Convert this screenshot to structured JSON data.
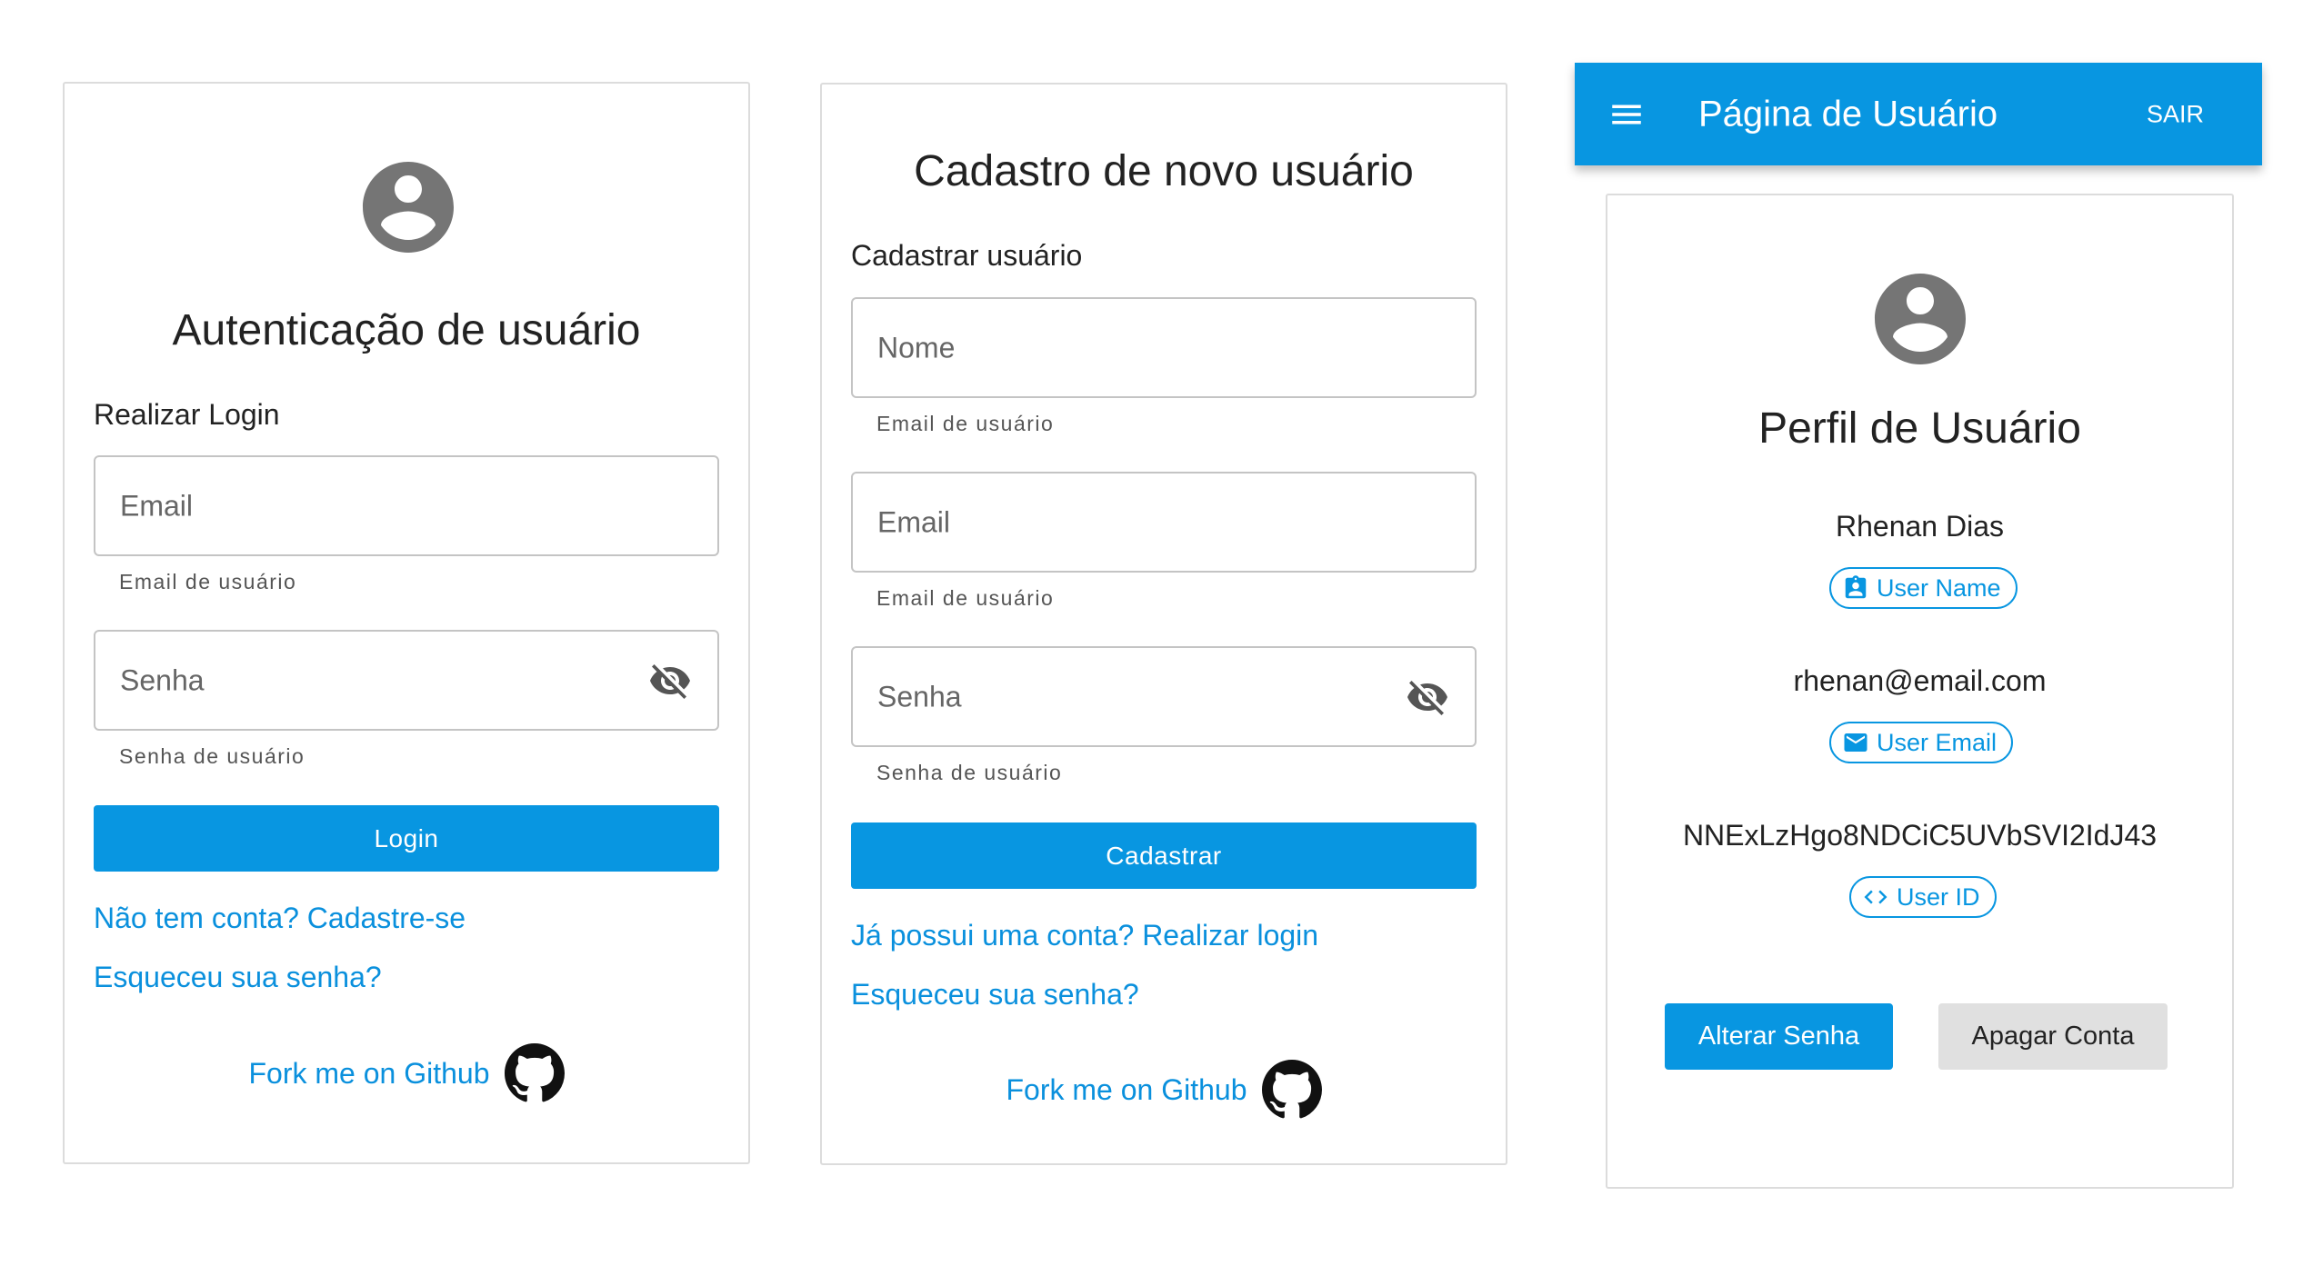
{
  "login": {
    "title": "Autenticação de usuário",
    "subtitle": "Realizar Login",
    "email_placeholder": "Email",
    "email_helper": "Email de usuário",
    "password_placeholder": "Senha",
    "password_helper": "Senha de usuário",
    "button": "Login",
    "register_link": "Não tem conta? Cadastre-se",
    "forgot_link": "Esqueceu sua senha?",
    "fork": "Fork me on Github"
  },
  "register": {
    "title": "Cadastro de novo usuário",
    "subtitle": "Cadastrar usuário",
    "name_placeholder": "Nome",
    "name_helper": "Email de usuário",
    "email_placeholder": "Email",
    "email_helper": "Email de usuário",
    "password_placeholder": "Senha",
    "password_helper": "Senha de usuário",
    "button": "Cadastrar",
    "login_link": "Já possui uma conta? Realizar login",
    "forgot_link": "Esqueceu sua senha?",
    "fork": "Fork me on Github"
  },
  "profile": {
    "appbar_title": "Página de Usuário",
    "logout": "SAIR",
    "title": "Perfil de Usuário",
    "name": "Rhenan Dias",
    "name_chip": "User Name",
    "email": "rhenan@email.com",
    "email_chip": "User Email",
    "user_id": "NNExLzHgo8NDCiC5UVbSVI2IdJ43",
    "id_chip": "User ID",
    "change_password": "Alterar Senha",
    "delete_account": "Apagar Conta"
  },
  "icons": {
    "avatar": "account-circle-icon",
    "eye": "visibility-off-icon",
    "github": "github-icon",
    "menu": "menu-icon",
    "badge": "badge-icon",
    "mail": "mail-icon",
    "code": "code-icon"
  },
  "colors": {
    "primary": "#0896e1",
    "link": "#0a90dd",
    "avatar": "#757575",
    "secondary_button": "#e0e0e0"
  }
}
